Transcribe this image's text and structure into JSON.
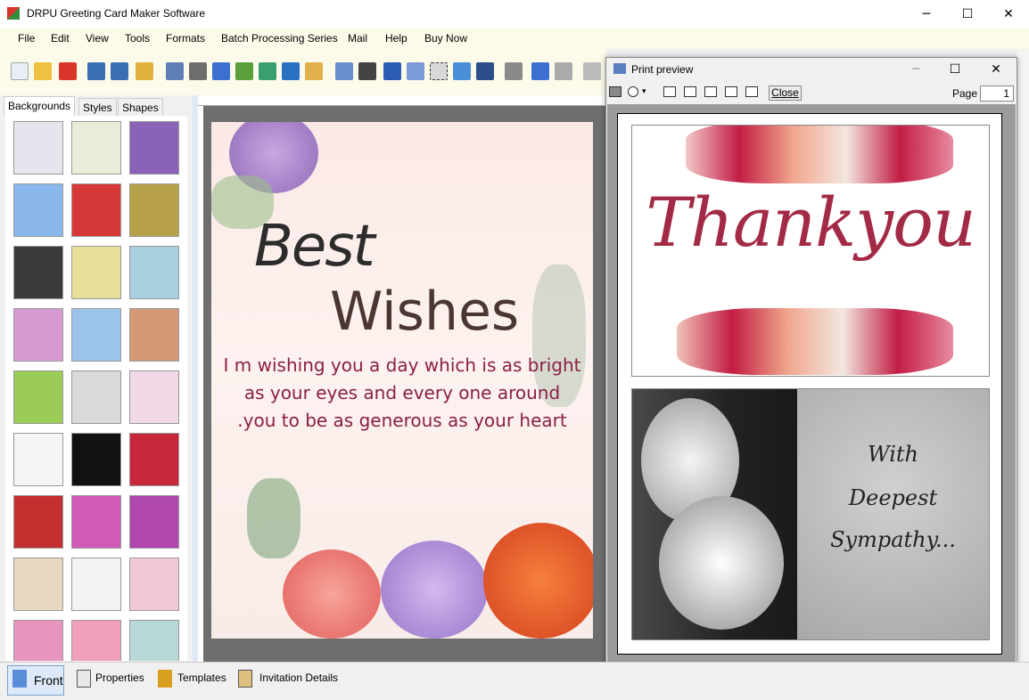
{
  "app": {
    "title": "DRPU Greeting Card Maker Software"
  },
  "window_controls": {
    "minimize": "─",
    "maximize": "☐",
    "close": "✕"
  },
  "menu": [
    "File",
    "Edit",
    "View",
    "Tools",
    "Formats",
    "Batch Processing Series",
    "Mail",
    "Help",
    "Buy Now"
  ],
  "left_tabs": [
    "Backgrounds",
    "Styles",
    "Shapes"
  ],
  "thumb_colors": [
    "#e8e4ee",
    "#e9ecd8",
    "#8a63b8",
    "#8ab8ec",
    "#d63838",
    "#b6a148",
    "#3b3b3b",
    "#e6df9a",
    "#a8cfe0",
    "#d79ad0",
    "#9cc4ea",
    "#d49a76",
    "#9ccc58",
    "#d9d9d9",
    "#f0d8e6",
    "#f4f4f4",
    "#111111",
    "#c8283c",
    "#c43030",
    "#d05ab6",
    "#b048b0",
    "#e8d8c0",
    "#f3f3f3",
    "#f2c8d6",
    "#e894c0",
    "#f0a0b8",
    "#b6d8d6"
  ],
  "card": {
    "title1": "Best",
    "title2": "Wishes",
    "lines": [
      "I m wishing you a day which is as bright",
      "as your eyes and every one around",
      ".you to be as generous as your heart"
    ]
  },
  "preview": {
    "title": "Print preview",
    "close_label": "Close",
    "page_label": "Page",
    "page_value": "1",
    "thank_text": "Thankyou",
    "sympathy_lines": [
      "With",
      "Deepest",
      "Sympathy..."
    ]
  },
  "bottom_tabs": [
    "Front",
    "Properties",
    "Templates",
    "Invitation Details"
  ]
}
